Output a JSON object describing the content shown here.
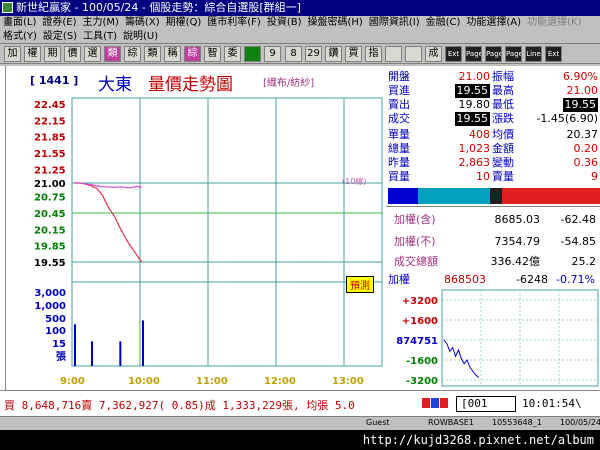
{
  "window": {
    "title": "新世紀贏家 - 100/05/24 - 個股走勢：綜合自選股[群組一]"
  },
  "menu1": [
    {
      "label": "畫面(L)"
    },
    {
      "label": "證券(E)"
    },
    {
      "label": "主力(M)"
    },
    {
      "label": "籌碼(X)"
    },
    {
      "label": "期權(Q)"
    },
    {
      "label": "匯市利率(F)"
    },
    {
      "label": "投資(B)"
    },
    {
      "label": "操盤密碼(H)"
    },
    {
      "label": "國際資訊(I)"
    },
    {
      "label": "金融(C)"
    },
    {
      "label": "功能選擇(A)"
    },
    {
      "label": "功能選擇(K)",
      "disabled": true
    }
  ],
  "menu2": [
    {
      "label": "格式(Y)"
    },
    {
      "label": "設定(S)"
    },
    {
      "label": "工具(T)"
    },
    {
      "label": "說明(U)"
    }
  ],
  "toolbar": [
    "加",
    "權",
    "期",
    "價",
    "選",
    "類",
    "綜",
    "類",
    "稱",
    "綜",
    "智",
    "委",
    "江",
    "9",
    "8",
    "29",
    "鑽",
    "買",
    "指",
    "",
    "",
    "成",
    "Ext",
    "Page",
    "Page",
    "Page",
    "Line",
    "Ext"
  ],
  "stock": {
    "code": "[ 1441 ]",
    "name": "大東",
    "chart_title": "量價走勢圖",
    "industry": "[織布/紡紗]"
  },
  "chart_badge": "預測",
  "ref_label": "(10線)",
  "chart_data": {
    "type": "line",
    "price_ticks": [
      "22.45",
      "22.15",
      "21.85",
      "21.55",
      "21.25",
      "21.00",
      "20.75",
      "20.45",
      "20.15",
      "19.85",
      "19.55"
    ],
    "price_tick_values": [
      22.45,
      22.15,
      21.85,
      21.55,
      21.25,
      21.0,
      20.75,
      20.45,
      20.15,
      19.85,
      19.55
    ],
    "ylim": [
      19.55,
      22.45
    ],
    "reference_price": 21.0,
    "volume_ticks": [
      "3,000",
      "1,000",
      "500",
      "100",
      "15",
      "張"
    ],
    "time_ticks": [
      "9:00",
      "10:00",
      "11:00",
      "12:00",
      "13:00"
    ],
    "time_tick_minutes": [
      0,
      60,
      120,
      180,
      240
    ],
    "xlim_minutes": [
      0,
      270
    ],
    "series": [
      {
        "type": "price",
        "x_minutes": [
          0,
          5,
          10,
          15,
          20,
          25,
          28,
          32,
          36,
          40,
          44,
          48,
          52,
          56,
          58,
          60
        ],
        "y": [
          21.0,
          21.0,
          20.98,
          20.95,
          20.9,
          20.78,
          20.65,
          20.5,
          20.38,
          20.2,
          20.05,
          19.9,
          19.78,
          19.66,
          19.6,
          19.55
        ],
        "color": "#e03050"
      },
      {
        "type": "average",
        "x_minutes": [
          0,
          5,
          10,
          15,
          20,
          25,
          30,
          35,
          40,
          45,
          50,
          55,
          60
        ],
        "y": [
          21.0,
          21.0,
          20.98,
          20.97,
          20.95,
          20.93,
          20.93,
          20.92,
          20.93,
          20.92,
          20.91,
          20.94,
          20.92
        ],
        "color": "#d050d0"
      }
    ],
    "volume_bars": {
      "x_minutes": [
        0,
        15,
        40,
        60
      ],
      "values": [
        220,
        130,
        130,
        240
      ],
      "color": "#0000c0"
    },
    "volume_ylim": [
      0,
      400
    ]
  },
  "quote": {
    "open_label": "開盤",
    "open": "21.00",
    "amp_label": "振幅",
    "amp": "6.90%",
    "bid_label": "買進",
    "bid": "19.55",
    "high_label": "最高",
    "high": "21.00",
    "ask_label": "賣出",
    "ask": "19.80",
    "low_label": "最低",
    "low": "19.55",
    "trade_label": "成交",
    "trade": "19.55",
    "chg_label": "漲跌",
    "chg": "-1.45(6.90)",
    "unit_label": "單量",
    "unit": "408",
    "avg_label": "均價",
    "avg": "20.37",
    "total_label": "總量",
    "total": "1,023",
    "amount_label": "金額",
    "amount": "0.20",
    "yest_label": "昨量",
    "yest": "2,863",
    "turn_label": "變動",
    "turn": "0.36",
    "buyvol_label": "買量",
    "buyvol": "10",
    "sellvol_label": "賣量",
    "sellvol": "9"
  },
  "index": {
    "r1_label": "加權(含)",
    "r1_val": "8685.03",
    "r1_chg": "-62.48",
    "r2_label": "加權(不)",
    "r2_val": "7354.79",
    "r2_chg": "-54.85",
    "r3_label": "成交總額",
    "r3_val": "336.42億",
    "r3_chg": "25.2"
  },
  "mini": {
    "label": "加權",
    "value": "868503",
    "chg": "-6248",
    "pct": "-0.71%",
    "ticks": [
      "+3200",
      "+1600",
      "874751",
      "-1600",
      "-3200"
    ],
    "chart_data": {
      "type": "line",
      "x": [
        0,
        5,
        10,
        15,
        20,
        25,
        30,
        35,
        40,
        45,
        50,
        55,
        60
      ],
      "y": [
        0,
        -300,
        -900,
        -600,
        -1300,
        -800,
        -1500,
        -1900,
        -1600,
        -2200,
        -2500,
        -2800,
        -3000
      ],
      "ylim": [
        -3200,
        3200
      ]
    }
  },
  "status": {
    "text": "買 8,648,716賣 7,362,927( 0.85)成 1,333,229張, 均張 5.0",
    "code_input": "[001",
    "clock": "10:01:54\\"
  },
  "bottom": {
    "guest": "Guest",
    "row": "ROWBASE1",
    "num": "10553648_1",
    "date": "100/05/24"
  },
  "watermark": "http://kujd3268.pixnet.net/album",
  "colors": {
    "price_line": "#e03050",
    "avg_line": "#d050d0",
    "volume": "#0000c0",
    "ref_line": "#40a0a0"
  }
}
